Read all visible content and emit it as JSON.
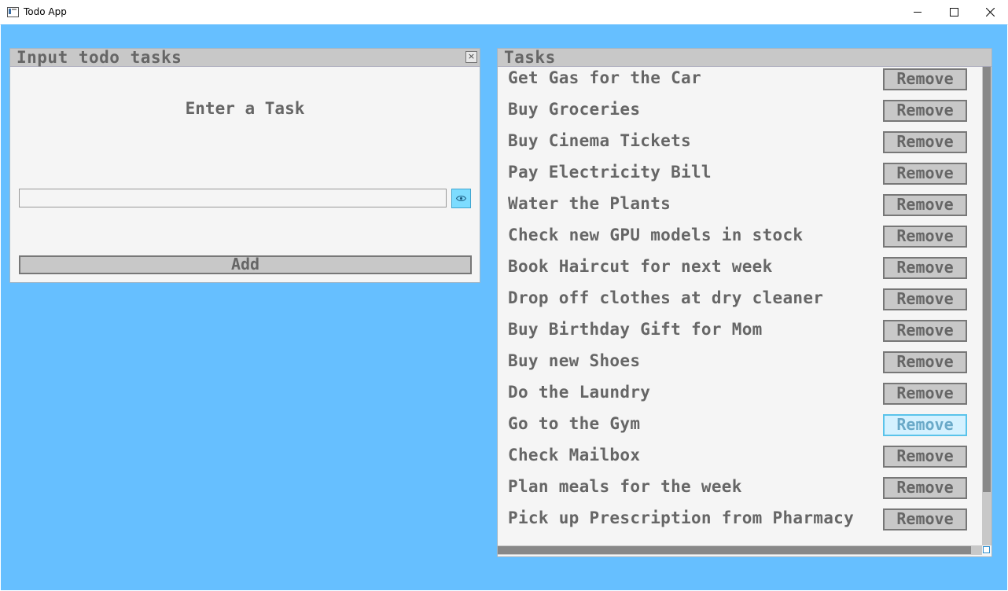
{
  "window": {
    "title": "Todo App"
  },
  "input_panel": {
    "title": "Input todo tasks",
    "prompt": "Enter a Task",
    "input_value": "",
    "add_label": "Add"
  },
  "tasks_panel": {
    "title": "Tasks",
    "remove_label": "Remove",
    "items": [
      "Get Gas for the Car",
      "Buy Groceries",
      "Buy Cinema Tickets",
      "Pay Electricity Bill",
      "Water the Plants",
      "Check new GPU models in stock",
      "Book Haircut for next week",
      "Drop off clothes at dry cleaner",
      "Buy Birthday Gift for Mom",
      "Buy new Shoes",
      "Do the Laundry",
      "Go to the Gym",
      "Check Mailbox",
      "Plan meals for the week",
      "Pick up Prescription from Pharmacy"
    ],
    "hovered_index": 11
  },
  "colors": {
    "desktop": "#66bfff",
    "panel": "#f5f5f5",
    "header": "#c8c8c8",
    "text": "#666666",
    "accent": "#7ddcff"
  },
  "icons": {
    "panel_close": "close-icon",
    "reveal": "eye-icon"
  }
}
